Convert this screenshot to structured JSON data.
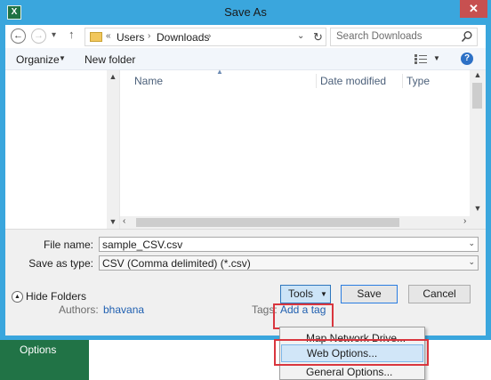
{
  "window": {
    "title": "Save As",
    "app_icon": "excel-icon",
    "close_label": "✕"
  },
  "address_bar": {
    "breadcrumbs": [
      "Users",
      "Downloads"
    ],
    "prefix": "«",
    "search_placeholder": "Search Downloads"
  },
  "toolbar": {
    "organize_label": "Organize",
    "new_folder_label": "New folder"
  },
  "file_list": {
    "columns": [
      "Name",
      "Date modified",
      "Type"
    ],
    "rows": []
  },
  "fields": {
    "file_name_label": "File name:",
    "file_name_value": "sample_CSV.csv",
    "save_as_type_label": "Save as type:",
    "save_as_type_value": "CSV (Comma delimited) (*.csv)",
    "authors_label": "Authors:",
    "authors_value": "bhavana",
    "tags_label": "Tags:",
    "tags_value": "Add a tag"
  },
  "buttons": {
    "hide_folders": "Hide Folders",
    "tools": "Tools",
    "save": "Save",
    "cancel": "Cancel"
  },
  "tools_menu": {
    "items": [
      "Map Network Drive...",
      "Web Options...",
      "General Options..."
    ],
    "highlighted": "Web Options..."
  },
  "background": {
    "options_label": "Options"
  },
  "colors": {
    "title_bar": "#3aa6dd",
    "excel_green": "#217346",
    "highlight_box": "#d9363e",
    "link": "#1f5fb0"
  }
}
